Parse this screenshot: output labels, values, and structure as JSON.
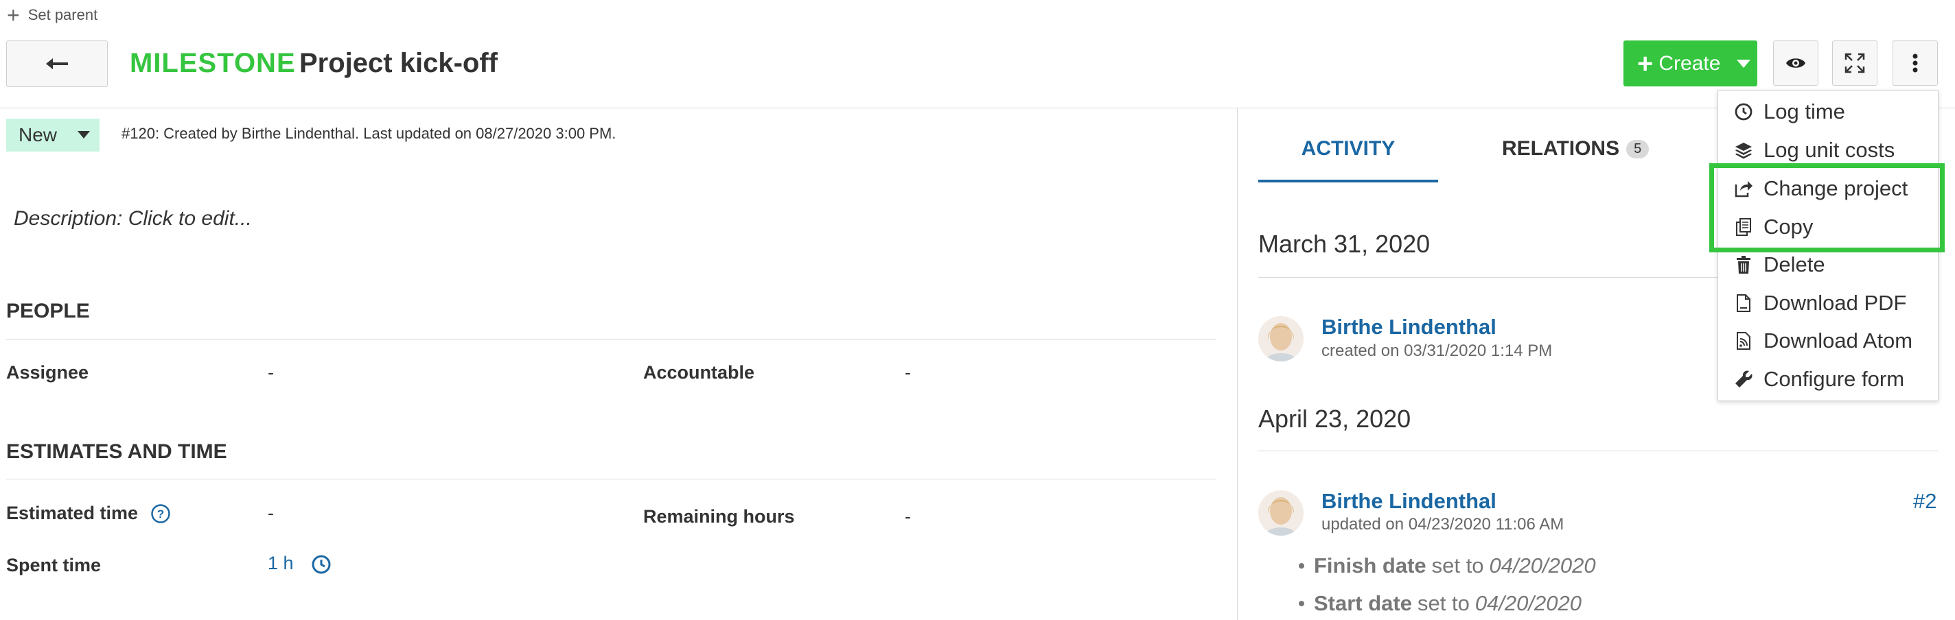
{
  "set_parent": {
    "label": "Set parent"
  },
  "header": {
    "type": "MILESTONE",
    "title": "Project kick-off",
    "create_label": "Create"
  },
  "status": {
    "value": "New",
    "meta": "#120: Created by Birthe Lindenthal. Last updated on 08/27/2020 3:00 PM."
  },
  "description": {
    "placeholder": "Description: Click to edit..."
  },
  "people": {
    "title": "PEOPLE",
    "assignee_label": "Assignee",
    "assignee_value": "-",
    "accountable_label": "Accountable",
    "accountable_value": "-"
  },
  "estimates": {
    "title": "ESTIMATES AND TIME",
    "estimated_label": "Estimated time",
    "estimated_value": "-",
    "remaining_label": "Remaining hours",
    "remaining_value": "-",
    "spent_label": "Spent time",
    "spent_value": "1 h"
  },
  "tabs": {
    "activity": "ACTIVITY",
    "relations": "RELATIONS",
    "relations_count": "5"
  },
  "activity": {
    "groups": [
      {
        "date": "March 31, 2020",
        "author": "Birthe Lindenthal",
        "meta": "created on 03/31/2020 1:14 PM"
      },
      {
        "date": "April 23, 2020",
        "author": "Birthe Lindenthal",
        "meta": "updated on 04/23/2020 11:06 AM",
        "number": "#2",
        "changes": [
          {
            "field": "Finish date",
            "text": "set to",
            "value": "04/20/2020"
          },
          {
            "field": "Start date",
            "text": "set to",
            "value": "04/20/2020"
          }
        ]
      }
    ]
  },
  "menu": {
    "items": [
      {
        "label": "Log time",
        "icon": "clock-icon"
      },
      {
        "label": "Log unit costs",
        "icon": "layers-icon"
      },
      {
        "label": "Change project",
        "icon": "move-icon"
      },
      {
        "label": "Copy",
        "icon": "copy-icon"
      },
      {
        "label": "Delete",
        "icon": "trash-icon"
      },
      {
        "label": "Download PDF",
        "icon": "pdf-icon"
      },
      {
        "label": "Download Atom",
        "icon": "atom-icon"
      },
      {
        "label": "Configure form",
        "icon": "wrench-icon"
      }
    ]
  },
  "colors": {
    "accent_green": "#35c53f",
    "link_blue": "#1a67a3",
    "status_bg": "#c9f5e2"
  }
}
